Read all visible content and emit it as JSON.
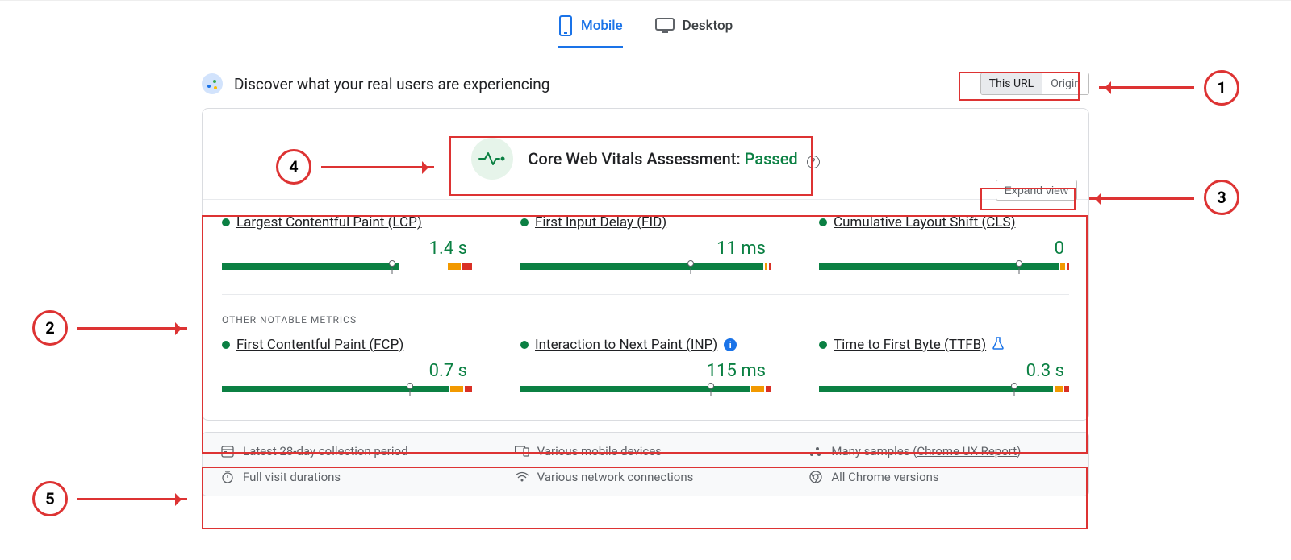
{
  "tabs": {
    "mobile": "Mobile",
    "desktop": "Desktop"
  },
  "discover": {
    "heading": "Discover what your real users are experiencing",
    "seg_this_url": "This URL",
    "seg_origin": "Origin"
  },
  "assessment": {
    "label": "Core Web Vitals Assessment: ",
    "status": "Passed"
  },
  "expand": "Expand view",
  "metrics": {
    "lcp": {
      "name": "Largest Contentful Paint (LCP)",
      "value": "1.4 s",
      "good": 70,
      "ok": 7,
      "bad": 4,
      "marker": 68
    },
    "fid": {
      "name": "First Input Delay (FID)",
      "value": "11 ms",
      "good": 96,
      "ok": 1,
      "bad": 0.5,
      "marker": 68
    },
    "cls": {
      "name": "Cumulative Layout Shift (CLS)",
      "value": "0",
      "good": 95,
      "ok": 2,
      "bad": 1,
      "marker": 80
    },
    "fcp": {
      "name": "First Contentful Paint (FCP)",
      "value": "0.7 s",
      "good": 87,
      "ok": 5,
      "bad": 3,
      "marker": 75
    },
    "inp": {
      "name": "Interaction to Next Paint (INP)",
      "value": "115 ms",
      "good": 88,
      "ok": 5,
      "bad": 2,
      "marker": 76
    },
    "ttfb": {
      "name": "Time to First Byte (TTFB)",
      "value": "0.3 s",
      "good": 92,
      "ok": 3,
      "bad": 2,
      "marker": 78
    }
  },
  "other_label": "OTHER NOTABLE METRICS",
  "info": {
    "period": "Latest 28-day collection period",
    "devices": "Various mobile devices",
    "samples": "Many samples",
    "samples_link": "Chrome UX Report",
    "durations": "Full visit durations",
    "network": "Various network connections",
    "versions": "All Chrome versions"
  },
  "annotations": {
    "n1": "1",
    "n2": "2",
    "n3": "3",
    "n4": "4",
    "n5": "5"
  }
}
